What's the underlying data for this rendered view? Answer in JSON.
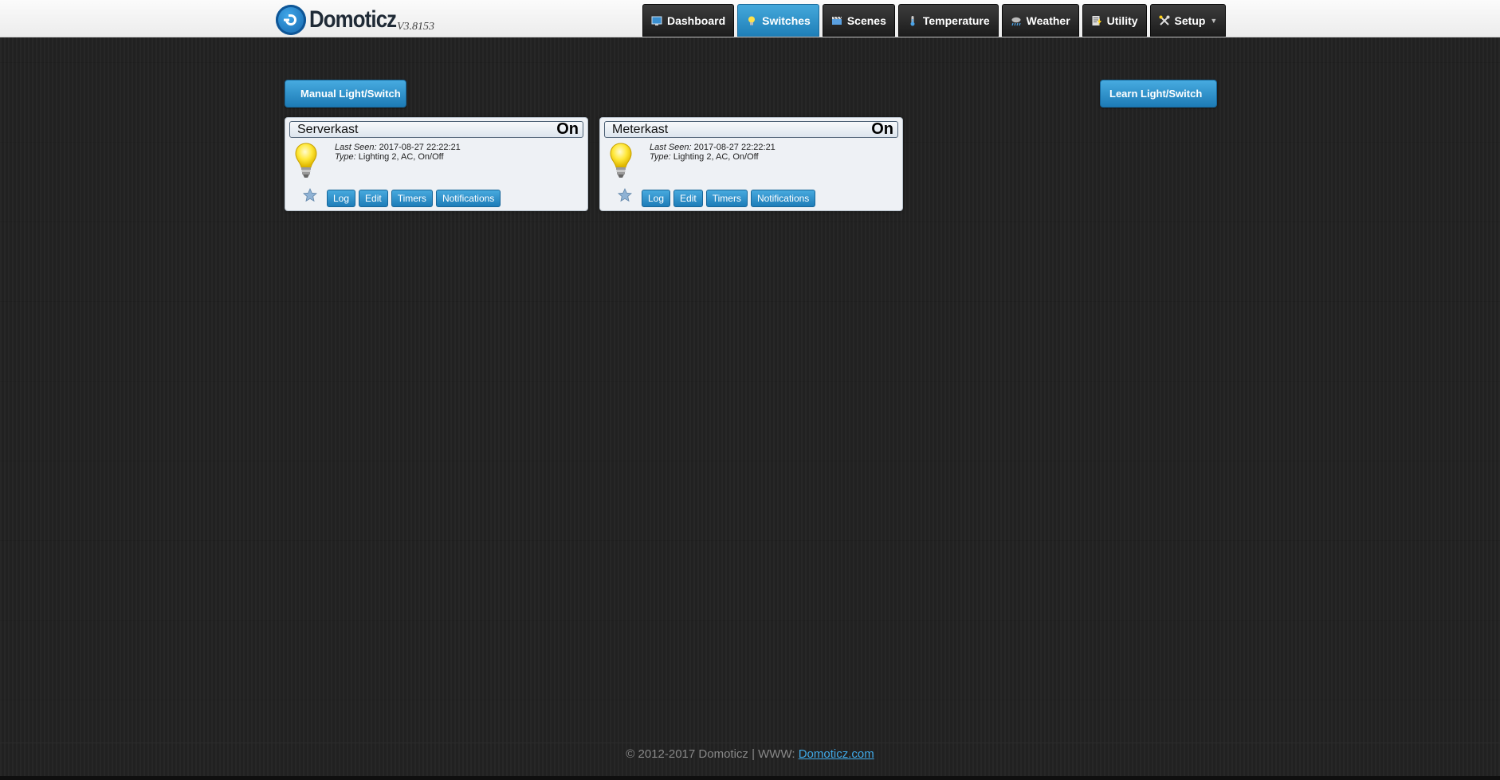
{
  "app": {
    "name": "Domoticz",
    "version": "V3.8153"
  },
  "nav": {
    "items": [
      {
        "label": "Dashboard",
        "icon": "dashboard-icon"
      },
      {
        "label": "Switches",
        "icon": "lightbulb-icon",
        "active": true
      },
      {
        "label": "Scenes",
        "icon": "scenes-icon"
      },
      {
        "label": "Temperature",
        "icon": "thermometer-icon"
      },
      {
        "label": "Weather",
        "icon": "weather-icon"
      },
      {
        "label": "Utility",
        "icon": "utility-icon"
      },
      {
        "label": "Setup",
        "icon": "tools-icon",
        "has_dropdown": true
      }
    ]
  },
  "actions": {
    "manual_label": "Manual Light/Switch",
    "learn_label": "Learn Light/Switch"
  },
  "devices": [
    {
      "name": "Serverkast",
      "status": "On",
      "last_seen_label": "Last Seen:",
      "last_seen": "2017-08-27 22:22:21",
      "type_label": "Type:",
      "type": "Lighting 2, AC, On/Off",
      "buttons": [
        "Log",
        "Edit",
        "Timers",
        "Notifications"
      ]
    },
    {
      "name": "Meterkast",
      "status": "On",
      "last_seen_label": "Last Seen:",
      "last_seen": "2017-08-27 22:22:21",
      "type_label": "Type:",
      "type": "Lighting 2, AC, On/Off",
      "buttons": [
        "Log",
        "Edit",
        "Timers",
        "Notifications"
      ]
    }
  ],
  "footer": {
    "text": "© 2012-2017 Domoticz | WWW:",
    "link": "Domoticz.com"
  },
  "colors": {
    "accent": "#2a8cc8",
    "background": "#232323",
    "nav_dark": "#2b2b2b"
  }
}
